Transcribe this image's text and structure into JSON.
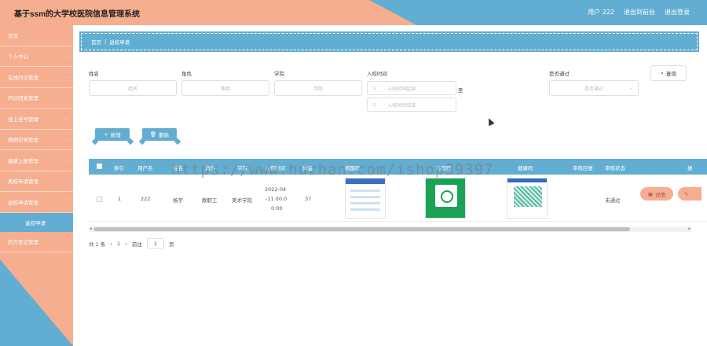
{
  "app": {
    "title": "基于ssm的大学校医院信息管理系统"
  },
  "header": {
    "user": "用户 222",
    "back_to_front": "退出到前台",
    "logout": "退出登录"
  },
  "sidebar": {
    "items": [
      {
        "label": "首页",
        "has_chevron": false
      },
      {
        "label": "个人中心",
        "has_chevron": true
      },
      {
        "label": "在线问诊管理",
        "has_chevron": true
      },
      {
        "label": "问诊回复管理",
        "has_chevron": true
      },
      {
        "label": "线上挂号管理",
        "has_chevron": true
      },
      {
        "label": "病例记录管理",
        "has_chevron": true
      },
      {
        "label": "健康上报管理",
        "has_chevron": true
      },
      {
        "label": "离校申请管理",
        "has_chevron": true
      },
      {
        "label": "返校申请管理",
        "has_chevron": true
      }
    ],
    "active_sub": "返校申请",
    "after_items": [
      {
        "label": "药方登记管理",
        "has_chevron": true
      }
    ]
  },
  "breadcrumb": {
    "home": "首页",
    "sep": "|",
    "current": "返校申请"
  },
  "filters": {
    "name_label": "姓名",
    "name_placeholder": "姓名",
    "role_label": "角色",
    "role_placeholder": "角色",
    "college_label": "学院",
    "college_placeholder": "学院",
    "time_label": "入校时间",
    "time_start_placeholder": "入校时间起始",
    "time_to": "至",
    "time_end_placeholder": "入校时间结束",
    "pass_label": "是否通过",
    "pass_placeholder": "是否通过",
    "search_label": "查询"
  },
  "actions": {
    "add_label": "新增",
    "delete_label": "删除"
  },
  "table": {
    "columns": [
      "索引",
      "用户名",
      "姓名",
      "角色",
      "学院",
      "入校时间",
      "体温",
      "核酸码",
      "行程码",
      "健康码",
      "审核回复",
      "审核状态",
      "操"
    ],
    "rows": [
      {
        "index": "1",
        "username": "222",
        "name": "杨宇",
        "role": "教职工",
        "college": "美术学院",
        "time_line1": "2022-04",
        "time_line2": "-11 00:0",
        "time_line3": "0:00",
        "temp": "37",
        "reply": "",
        "status": "未通过",
        "detail_label": "详情"
      }
    ]
  },
  "pager": {
    "total": "共 1 条",
    "prev": "‹",
    "page": "1",
    "next": "›",
    "goto_label": "前往",
    "goto_value": "1",
    "page_unit": "页"
  },
  "watermark": "https://www.huzhan.com/ishop39397",
  "colors": {
    "accent_blue": "#62aed2",
    "accent_salmon": "#f5ae8f"
  }
}
